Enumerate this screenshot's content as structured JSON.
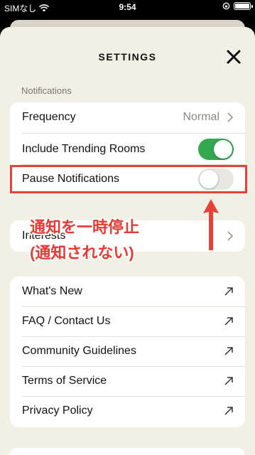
{
  "status_bar": {
    "carrier": "SIMなし",
    "time": "9:54"
  },
  "header": {
    "title": "SETTINGS",
    "close_icon": "close-icon"
  },
  "notifications": {
    "section_label": "Notifications",
    "frequency": {
      "label": "Frequency",
      "value": "Normal"
    },
    "trending": {
      "label": "Include Trending Rooms",
      "enabled": true
    },
    "pause": {
      "label": "Pause Notifications",
      "enabled": false
    }
  },
  "interests": {
    "label": "Interests"
  },
  "links": [
    {
      "label": "What's New"
    },
    {
      "label": "FAQ / Contact Us"
    },
    {
      "label": "Community Guidelines"
    },
    {
      "label": "Terms of Service"
    },
    {
      "label": "Privacy Policy"
    }
  ],
  "annotation": {
    "line1": "通知を一時停止",
    "line2": "(通知されない)",
    "color": "#e53a35"
  },
  "colors": {
    "toggle_on": "#33a84f",
    "highlight": "#e8413a",
    "background": "#f2efe4"
  }
}
